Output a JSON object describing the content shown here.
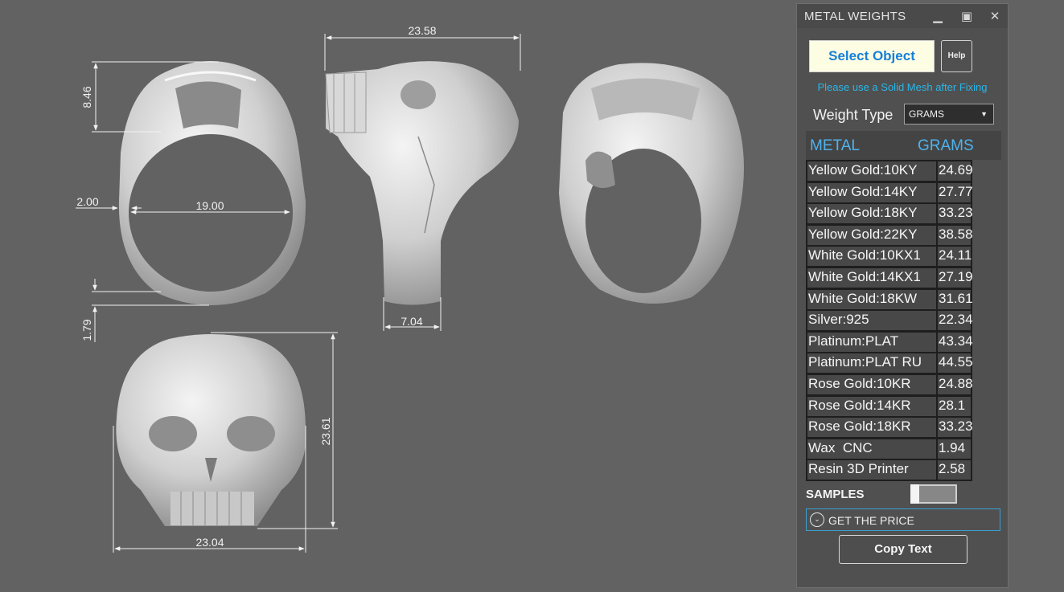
{
  "viewport": {
    "dimensions": {
      "top_width": "23.58",
      "head_height": "8.46",
      "shank_width": "2.00",
      "inner_diameter": "19.00",
      "bottom_thickness": "1.79",
      "side_shank_width": "7.04",
      "front_height": "23.61",
      "front_width": "23.04"
    }
  },
  "panel": {
    "title": "METAL WEIGHTS",
    "minimize_icon": "minimize-icon",
    "maximize_icon": "maximize-icon",
    "close_icon": "close-icon",
    "select_object_label": "Select Object",
    "help_label": "Help",
    "hint": "Please use a Solid Mesh after Fixing",
    "weight_type_label": "Weight Type",
    "weight_type_value": "GRAMS",
    "table_header": {
      "metal": "METAL",
      "grams": "GRAMS"
    },
    "rows": [
      {
        "metal": "Yellow Gold:10KY",
        "grams": "24.69"
      },
      {
        "metal": "Yellow Gold:14KY",
        "grams": "27.77"
      },
      {
        "metal": "Yellow Gold:18KY",
        "grams": "33.23"
      },
      {
        "metal": "Yellow Gold:22KY",
        "grams": "38.58"
      },
      {
        "metal": "White Gold:10KX1",
        "grams": "24.11"
      },
      {
        "metal": "White Gold:14KX1",
        "grams": "27.19"
      },
      {
        "metal": "White Gold:18KW",
        "grams": "31.61"
      },
      {
        "metal": "Silver:925",
        "grams": "22.34"
      },
      {
        "metal": "Platinum:PLAT",
        "grams": "43.34"
      },
      {
        "metal": "Platinum:PLAT RU",
        "grams": "44.55"
      },
      {
        "metal": "Rose Gold:10KR",
        "grams": "24.88"
      },
      {
        "metal": "Rose Gold:14KR",
        "grams": "28.1"
      },
      {
        "metal": "Rose Gold:18KR",
        "grams": "33.23"
      },
      {
        "metal": "Wax  CNC",
        "grams": "1.94"
      },
      {
        "metal": "Resin 3D Printer",
        "grams": "2.58"
      }
    ],
    "samples_label": "SAMPLES",
    "samples_enabled": false,
    "get_price_label": "GET THE PRICE",
    "copy_text_label": "Copy Text",
    "accent_color": "#29b6e8"
  }
}
